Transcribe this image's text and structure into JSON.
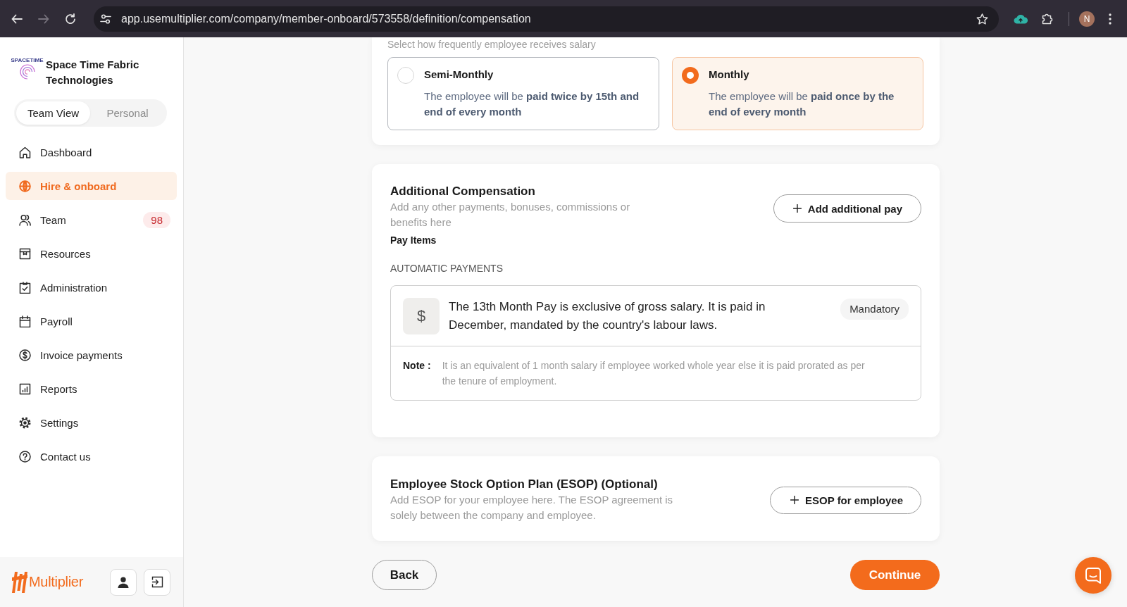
{
  "browser": {
    "nav_buttons": [
      {
        "disabled": false
      },
      {
        "disabled": true
      },
      {
        "disabled": false
      }
    ],
    "url": "app.usemultiplier.com/company/member-onboard/573558/definition/compensation",
    "profile_initial": "N"
  },
  "sidebar": {
    "logo_text": "SPACETIME",
    "company": "Space Time Fabric Technologies",
    "view_toggle": [
      {
        "label": "Team View",
        "selected": true
      },
      {
        "label": "Personal",
        "selected": false
      }
    ],
    "nav": [
      {
        "label": "Dashboard",
        "selected": false
      },
      {
        "label": "Hire & onboard",
        "selected": true
      },
      {
        "label": "Team",
        "badge": "98",
        "selected": false
      },
      {
        "label": "Resources",
        "selected": false
      },
      {
        "label": "Administration",
        "selected": false
      },
      {
        "label": "Payroll",
        "selected": false
      },
      {
        "label": "Invoice payments",
        "selected": false
      },
      {
        "label": "Reports",
        "selected": false
      },
      {
        "label": "Settings",
        "selected": false
      },
      {
        "label": "Contact us",
        "selected": false
      }
    ],
    "brand": "Multiplier"
  },
  "main": {
    "pay_frequency": {
      "hint": "Select how frequently employee receives salary",
      "options": [
        {
          "title": "Semi-Monthly",
          "description": "The employee will be **paid twice by 15th and end of every month**",
          "selected": false
        },
        {
          "title": "Monthly",
          "description": "The employee will be **paid once by the end of every month**",
          "selected": true
        }
      ]
    },
    "additional_compensation": {
      "title": "Additional Compensation",
      "description": "Add any other payments, bonuses, commissions or benefits here",
      "button": "Add additional pay",
      "pay_items_label": "Pay Items",
      "section_label": "AUTOMATIC PAYMENTS",
      "items": [
        {
          "symbol": "$",
          "text": "The 13th Month Pay is exclusive of gross salary. It is paid in December, mandated by the country's labour laws.",
          "tag": "Mandatory",
          "note_label": "Note :",
          "note": "It is an equivalent of 1 month salary if employee worked whole year else it is paid prorated as per the tenure of employment."
        }
      ]
    },
    "esop": {
      "title": "Employee Stock Option Plan (ESOP) (Optional)",
      "description": "Add ESOP for your employee here. The ESOP agreement is solely between the company and employee.",
      "button": "ESOP for employee"
    },
    "actions": {
      "back": "Back",
      "continue": "Continue"
    }
  }
}
